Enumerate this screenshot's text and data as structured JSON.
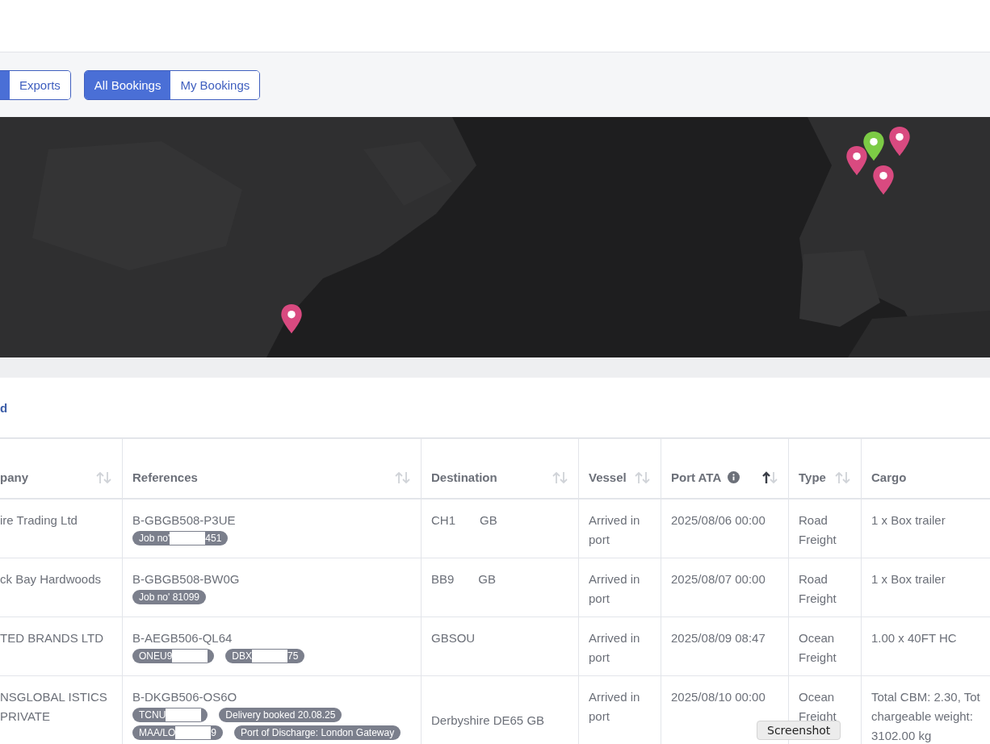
{
  "toolbar": {
    "direction_toggle": [
      {
        "label": "Exports",
        "selected": false
      }
    ],
    "scope_toggle": [
      {
        "label": "All Bookings",
        "selected": true
      },
      {
        "label": "My Bookings",
        "selected": false
      }
    ]
  },
  "map": {
    "kind": "picture",
    "markers": [
      {
        "color": "#d94a80"
      },
      {
        "color": "#d94a80"
      },
      {
        "color": "#d94a80"
      },
      {
        "color": "#7ccb45"
      },
      {
        "color": "#d94a80"
      }
    ]
  },
  "panel": {
    "link": "d"
  },
  "table": {
    "columns": [
      {
        "label": "pany",
        "sortable": true,
        "sorted": false,
        "info": false
      },
      {
        "label": "References",
        "sortable": true,
        "sorted": false,
        "info": false
      },
      {
        "label": "Destination",
        "sortable": true,
        "sorted": false,
        "info": false
      },
      {
        "label": "Vessel",
        "sortable": true,
        "sorted": false,
        "info": false
      },
      {
        "label": "Port ATA",
        "sortable": true,
        "sorted": true,
        "info": true
      },
      {
        "label": "Type",
        "sortable": true,
        "sorted": false,
        "info": false
      },
      {
        "label": "Cargo",
        "sortable": false,
        "info": false
      }
    ],
    "rows": [
      {
        "company": "ire Trading Ltd",
        "reference": "B-GBGB508-P3UE",
        "tags": [
          {
            "before": "Job no'",
            "after": "451",
            "redacted": true
          }
        ],
        "destination": [
          "CH1",
          "GB"
        ],
        "vessel": "Arrived in port",
        "port_ata": "2025/08/06 00:00",
        "type": "Road Freight",
        "cargo": "1 x Box trailer"
      },
      {
        "company": "ck Bay Hardwoods",
        "reference": "B-GBGB508-BW0G",
        "tags": [
          {
            "before": "Job no' 81099",
            "redacted": false
          }
        ],
        "destination": [
          "BB9",
          "GB"
        ],
        "vessel": "Arrived in port",
        "port_ata": "2025/08/07 00:00",
        "type": "Road Freight",
        "cargo": "1 x Box trailer"
      },
      {
        "company": "TED BRANDS LTD",
        "reference": "B-AEGB506-QL64",
        "tags": [
          {
            "before": "ONEU9",
            "redacted": true
          },
          {
            "before": "DBX",
            "after": "75",
            "redacted": true
          }
        ],
        "destination": [
          "GBSOU"
        ],
        "vessel": "Arrived in port",
        "port_ata": "2025/08/09 08:47",
        "type": "Ocean Freight",
        "cargo": "1.00 x 40FT HC"
      },
      {
        "company": "NSGLOBAL ISTICS PRIVATE",
        "reference": "B-DKGB506-OS6O",
        "tags": [
          {
            "before": "TCNU",
            "redacted": true
          },
          {
            "before": "Delivery booked 20.08.25",
            "redacted": false
          },
          {
            "before": "MAA/LO",
            "after": "9",
            "redacted": true
          },
          {
            "before": "Port of Discharge: London Gateway",
            "redacted": false
          }
        ],
        "destination": [
          "Derbyshire DE65 GB"
        ],
        "vessel": "Arrived in port",
        "port_ata": "2025/08/10 00:00",
        "type": "Ocean Freight",
        "cargo": "Total CBM: 2.30, Tot chargeable weight: 3102.00 kg"
      }
    ]
  },
  "tooltip": {
    "text": "Screenshot"
  }
}
